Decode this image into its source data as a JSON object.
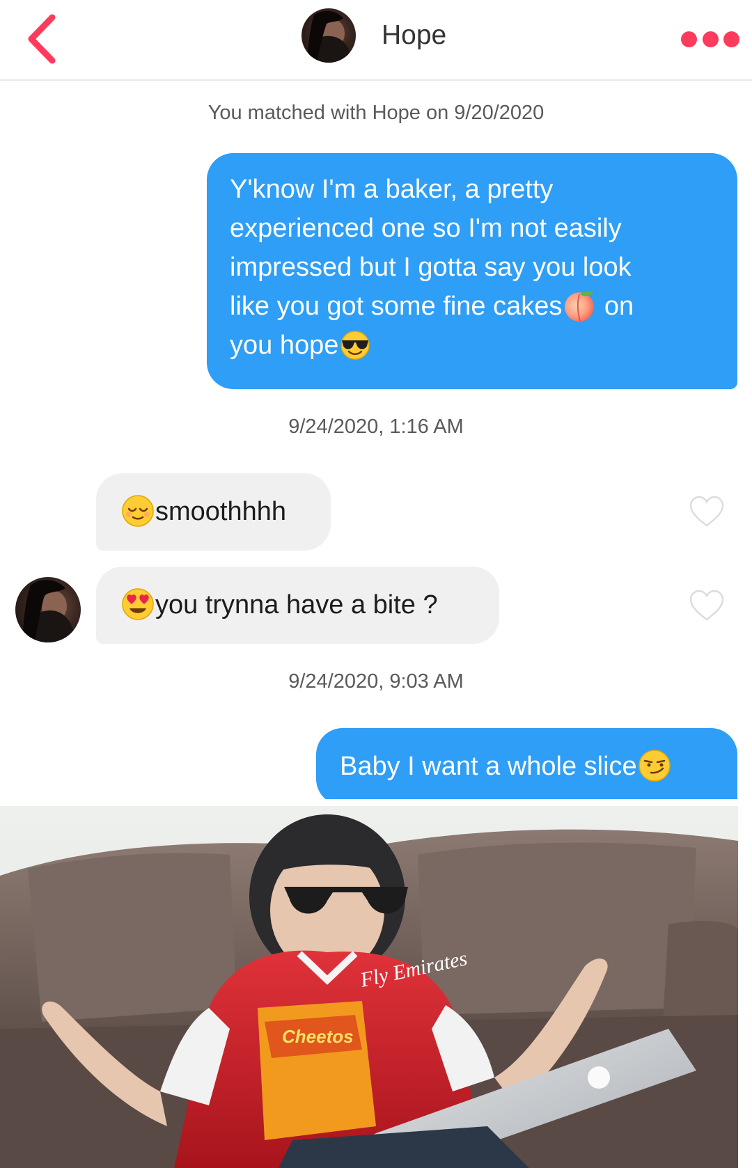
{
  "header": {
    "contact_name": "Hope",
    "back_icon": "chevron-left-icon",
    "more_icon": "more-dots-icon",
    "accent_color": "#fd3b5d"
  },
  "match_notice": "You matched with Hope on 9/20/2020",
  "messages": [
    {
      "direction": "sent",
      "parts": [
        "Y'know I'm a baker, a pretty experienced one so I'm not easily impressed but I gotta say you look like you got some fine cakes",
        "peach-emoji",
        " on you hope",
        "sunglasses-emoji"
      ],
      "line1": "Y'know I'm a baker, a pretty",
      "line2": "experienced one so I'm not easily",
      "line3": "impressed but I gotta say you look",
      "line4a": "like you got some fine cakes",
      "line4b": " on",
      "line5": "you hope",
      "emojis": [
        "peach-emoji",
        "sunglasses-emoji"
      ]
    },
    {
      "direction": "timestamp",
      "text": "9/24/2020, 1:16 AM"
    },
    {
      "direction": "received",
      "text": "smoothhhh",
      "emoji": "relieved-face-emoji"
    },
    {
      "direction": "received",
      "text": "you trynna have a bite ?",
      "emoji": "heart-eyes-emoji"
    },
    {
      "direction": "timestamp",
      "text": "9/24/2020, 9:03 AM"
    },
    {
      "direction": "sent",
      "text": "Baby I want a whole slice",
      "emoji": "smirk-emoji"
    }
  ],
  "colors": {
    "sent_bubble": "#2e9ef7",
    "received_bubble": "#f0f0f0",
    "heart_outline": "#dcdcdc"
  },
  "meme": {
    "description_icon": "meme-photo",
    "shirt_text": "Fly Emirates",
    "snack_text": "Cheetos"
  }
}
